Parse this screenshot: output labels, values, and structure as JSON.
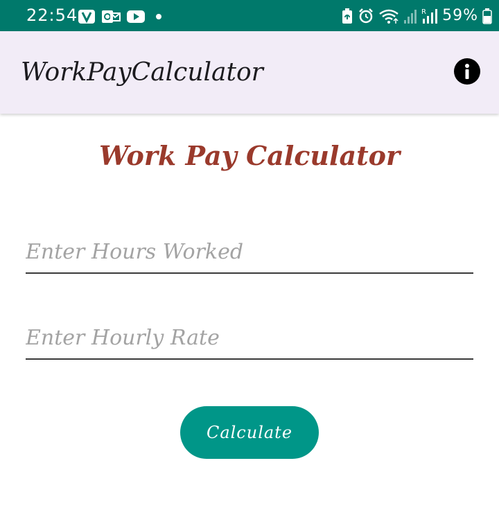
{
  "status_bar": {
    "time": "22:54",
    "battery_percent": "59%",
    "left_icons": [
      "viber-icon",
      "outlook-icon",
      "youtube-icon",
      "notification-dot-icon"
    ],
    "right_icons": [
      "battery-saver-icon",
      "alarm-icon",
      "wifi-icon",
      "signal-icon",
      "roaming-signal-icon",
      "battery-icon"
    ]
  },
  "app_bar": {
    "title": "WorkPayCalculator"
  },
  "main": {
    "heading": "Work Pay Calculator",
    "hours_input": {
      "value": "",
      "placeholder": "Enter Hours Worked"
    },
    "rate_input": {
      "value": "",
      "placeholder": "Enter Hourly Rate"
    },
    "calculate_label": "Calculate"
  },
  "colors": {
    "status_bar": "#00796b",
    "app_bar": "#f2ecf7",
    "heading": "#9a3a2c",
    "button": "#009688",
    "placeholder": "#a3a3a3"
  }
}
